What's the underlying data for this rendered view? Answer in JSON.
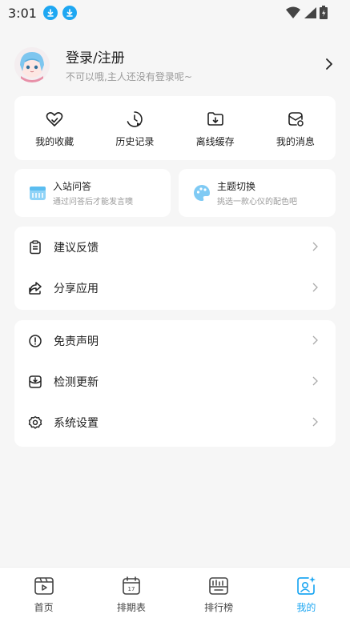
{
  "status_bar": {
    "time": "3:01",
    "icons": [
      "download-icon",
      "download-icon",
      "wifi-icon",
      "signal-icon",
      "battery-icon"
    ]
  },
  "profile": {
    "title": "登录/注册",
    "subtitle": "不可以哦,主人还没有登录呢~"
  },
  "quick_actions": [
    {
      "label": "我的收藏",
      "icon": "heart-icon"
    },
    {
      "label": "历史记录",
      "icon": "history-clock-icon"
    },
    {
      "label": "离线缓存",
      "icon": "download-folder-icon"
    },
    {
      "label": "我的消息",
      "icon": "mail-icon"
    }
  ],
  "promos": [
    {
      "title": "入站问答",
      "subtitle": "通过问答后才能发言噢",
      "icon": "quiz-icon"
    },
    {
      "title": "主题切换",
      "subtitle": "挑选一款心仪的配色吧",
      "icon": "palette-icon"
    }
  ],
  "menu_group_1": [
    {
      "label": "建议反馈",
      "icon": "clipboard-icon"
    },
    {
      "label": "分享应用",
      "icon": "share-icon"
    }
  ],
  "menu_group_2": [
    {
      "label": "免责声明",
      "icon": "info-icon"
    },
    {
      "label": "检测更新",
      "icon": "update-icon"
    },
    {
      "label": "系统设置",
      "icon": "gear-icon"
    }
  ],
  "tabs": [
    {
      "label": "首页",
      "icon": "home-video-icon",
      "active": false
    },
    {
      "label": "排期表",
      "icon": "calendar-icon",
      "active": false
    },
    {
      "label": "排行榜",
      "icon": "ranking-icon",
      "active": false
    },
    {
      "label": "我的",
      "icon": "profile-icon",
      "active": true
    }
  ],
  "colors": {
    "accent": "#1ea7f2",
    "background": "#f6f6f6",
    "card": "#ffffff",
    "text": "#222222",
    "muted": "#9a9a9a"
  }
}
